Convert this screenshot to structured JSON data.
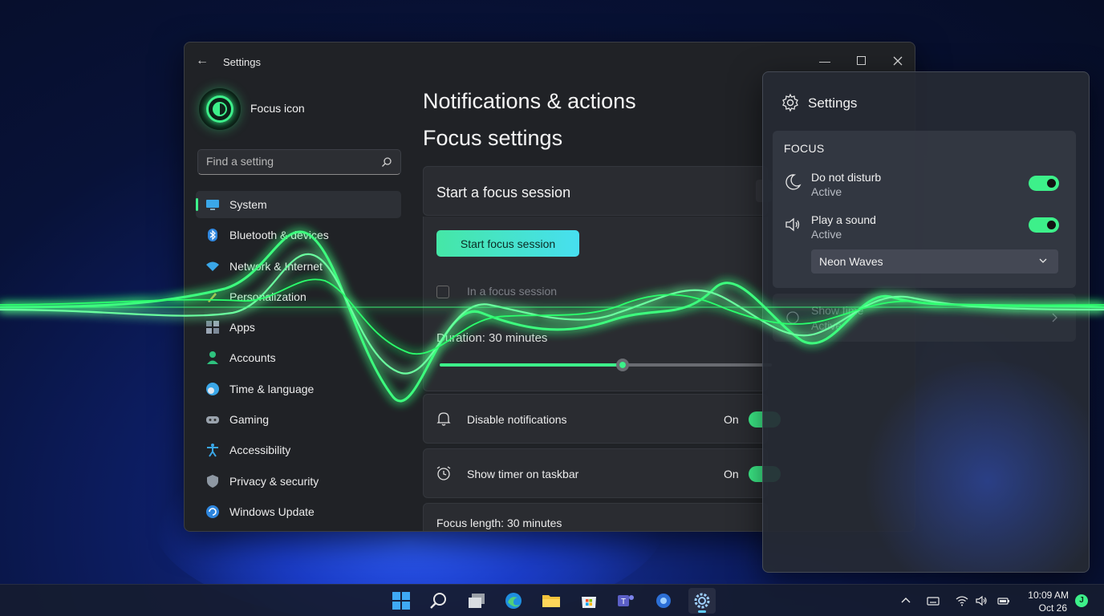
{
  "window": {
    "title": "Settings",
    "profile_name": "Focus icon",
    "search_placeholder": "Find a setting"
  },
  "sidebar": {
    "items": [
      {
        "label": "System",
        "icon": "monitor-icon",
        "active": true
      },
      {
        "label": "Bluetooth & devices",
        "icon": "bluetooth-icon"
      },
      {
        "label": "Network & Internet",
        "icon": "wifi-icon"
      },
      {
        "label": "Personalization",
        "icon": "brush-icon"
      },
      {
        "label": "Apps",
        "icon": "apps-icon"
      },
      {
        "label": "Accounts",
        "icon": "person-icon"
      },
      {
        "label": "Time & language",
        "icon": "globe-clock-icon"
      },
      {
        "label": "Gaming",
        "icon": "gamepad-icon"
      },
      {
        "label": "Accessibility",
        "icon": "accessibility-icon"
      },
      {
        "label": "Privacy & security",
        "icon": "shield-icon"
      },
      {
        "label": "Windows Update",
        "icon": "update-icon"
      }
    ]
  },
  "main": {
    "heading": "Notifications & actions",
    "subheading": "Focus settings",
    "session_card_title": "Start a focus session",
    "start_button": "Start focus session",
    "checkbox_label": "In a focus session",
    "duration_label": "Duration: 30 minutes",
    "duration_fraction": 0.55,
    "rows": [
      {
        "label": "Disable notifications",
        "state": "On",
        "icon": "bell-icon"
      },
      {
        "label": "Show timer on taskbar",
        "state": "On",
        "icon": "alarm-clock-icon"
      }
    ],
    "focus_length_label": "Focus length: 30 minutes"
  },
  "panel": {
    "title": "Settings",
    "section_label": "FOCUS",
    "items": [
      {
        "title": "Do not disturb",
        "status": "Active",
        "icon": "moon-icon",
        "enabled": true
      },
      {
        "title": "Play a sound",
        "status": "Active",
        "icon": "speaker-icon",
        "enabled": true
      }
    ],
    "sound_select_value": "Neon Waves",
    "dim_row": {
      "title": "Show time",
      "status": "Active"
    }
  },
  "taskbar": {
    "time": "10:09 AM",
    "date": "Oct 26",
    "badge": "J",
    "apps": [
      "start-icon",
      "search-icon",
      "task-view-icon",
      "edge-icon",
      "file-explorer-icon",
      "store-icon",
      "teams-icon",
      "copilot-icon",
      "settings-gear-icon"
    ]
  },
  "colors": {
    "accent": "#3df08a",
    "wave_glow": "#39ff7a",
    "window_bg": "#202226",
    "start_button_gradient": [
      "#45e7a6",
      "#47dff0"
    ]
  }
}
